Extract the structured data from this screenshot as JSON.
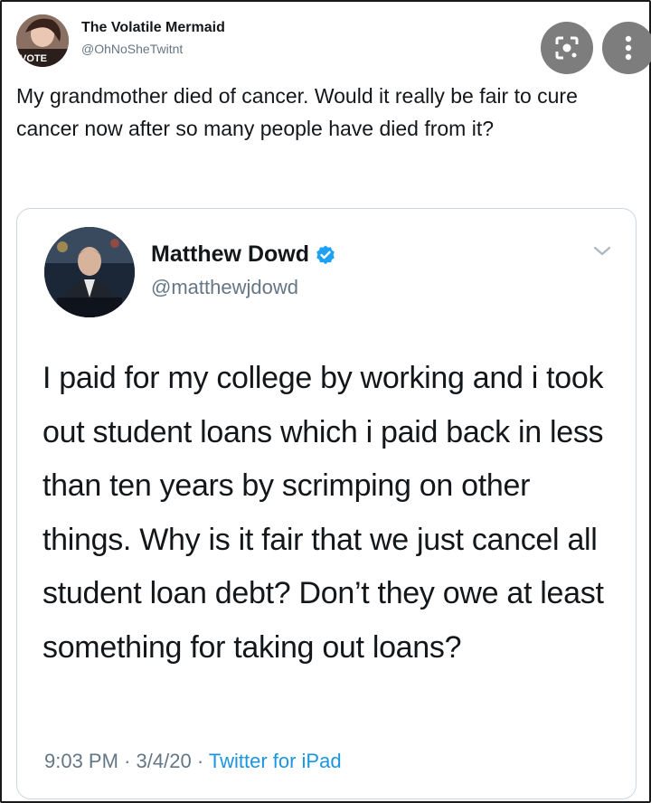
{
  "outer_tweet": {
    "avatar_badge": "VOTE",
    "display_name": "The Volatile Mermaid",
    "handle": "@OhNoSheTwitnt",
    "text": "My grandmother died of cancer. Would it really be fair to cure cancer now after so many people have died from it?"
  },
  "overlay_buttons": {
    "lens_icon": "lens-search-icon",
    "more_icon": "more-vertical-icon"
  },
  "quoted_tweet": {
    "display_name": "Matthew Dowd",
    "verified_icon": "verified-badge-icon",
    "handle": "@matthewjdowd",
    "text": "I paid for my college by working and i took out student loans which i paid back in less than ten years by scrimping on other things.  Why is it fair that we just cancel all student loan debt? Don’t they owe at least something for taking out loans?",
    "time": "9:03 PM",
    "separator": "·",
    "date": "3/4/20",
    "source": "Twitter for iPad"
  },
  "colors": {
    "link_blue": "#1b95e0",
    "secondary_text": "#657786",
    "verified_blue": "#1da1f2"
  }
}
